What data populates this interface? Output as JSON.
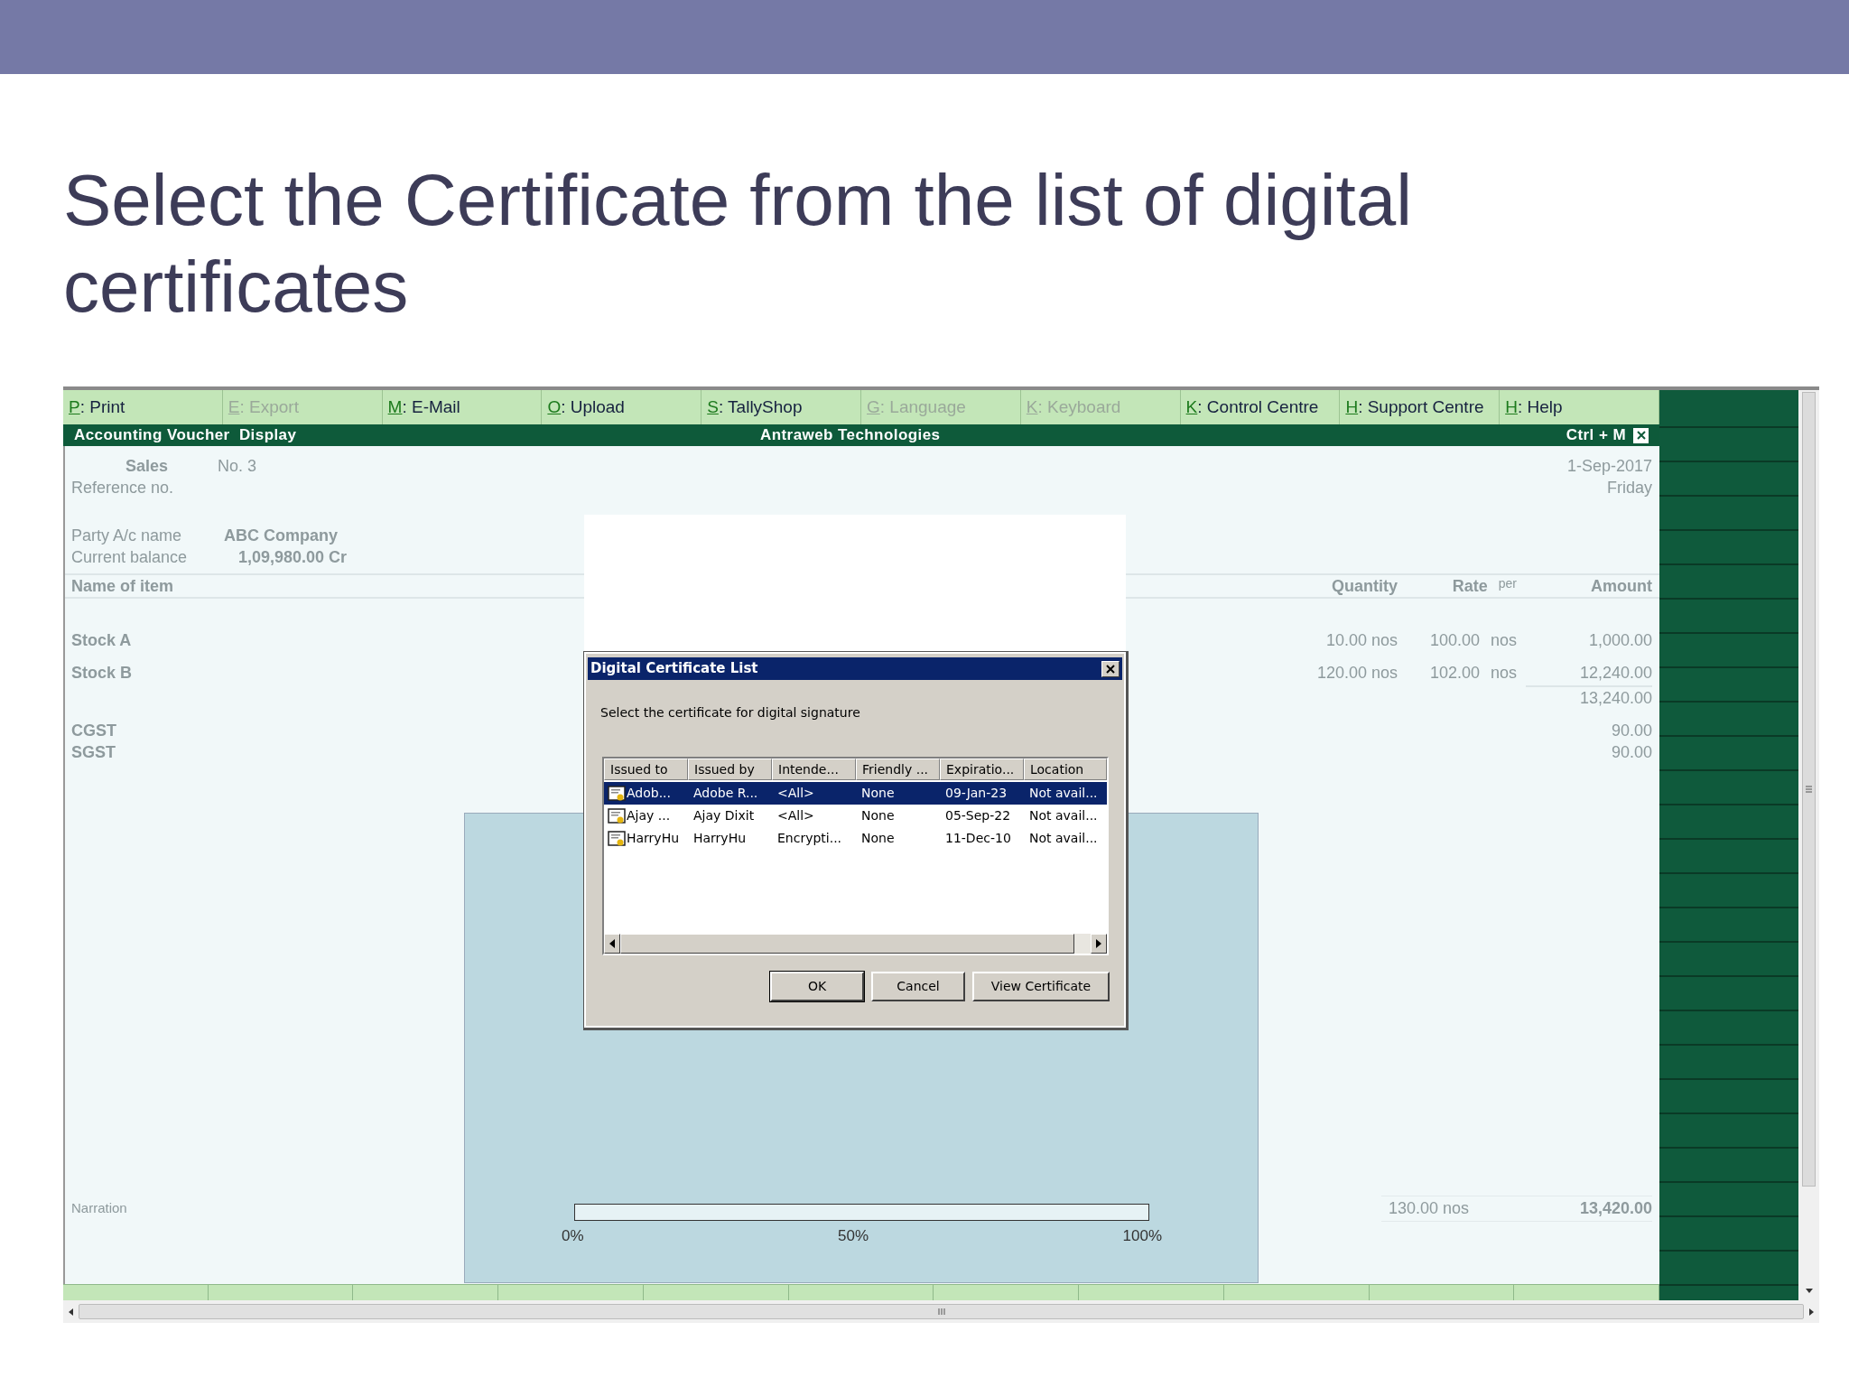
{
  "slide": {
    "title": "Select the Certificate from the list of digital certificates"
  },
  "menu": [
    {
      "key": "P",
      "label": ": Print",
      "disabled": false
    },
    {
      "key": "E",
      "label": ": Export",
      "disabled": true
    },
    {
      "key": "M",
      "label": ": E-Mail",
      "disabled": false
    },
    {
      "key": "O",
      "label": ": Upload",
      "disabled": false
    },
    {
      "key": "S",
      "label": ": TallyShop",
      "disabled": false
    },
    {
      "key": "G",
      "label": ": Language",
      "disabled": true
    },
    {
      "key": "K",
      "label": ": Keyboard",
      "disabled": true
    },
    {
      "key": "K",
      "label": ": Control Centre",
      "disabled": false
    },
    {
      "key": "H",
      "label": ": Support Centre",
      "disabled": false
    },
    {
      "key": "H",
      "label": ": Help",
      "disabled": false
    }
  ],
  "title_bar": {
    "screen": "Accounting Voucher  Display",
    "company": "Antraweb Technologies",
    "shortcut": "Ctrl + M"
  },
  "voucher": {
    "type": "Sales",
    "number": "No. 3",
    "date": "1-Sep-2017",
    "day": "Friday",
    "reference_label": "Reference no.",
    "party_label": "Party A/c name",
    "party": "ABC Company",
    "balance_label": "Current balance",
    "balance": "1,09,980.00 Cr",
    "columns": {
      "item": "Name of item",
      "quantity": "Quantity",
      "rate": "Rate",
      "per": "per",
      "amount": "Amount"
    },
    "items": [
      {
        "name": "Stock A",
        "quantity": "10.00 nos",
        "rate": "100.00",
        "unit": "nos",
        "amount": "1,000.00"
      },
      {
        "name": "Stock B",
        "quantity": "120.00 nos",
        "rate": "102.00",
        "unit": "nos",
        "amount": "12,240.00"
      }
    ],
    "subtotal": "13,240.00",
    "taxes": [
      {
        "name": "CGST",
        "amount": "90.00"
      },
      {
        "name": "SGST",
        "amount": "90.00"
      }
    ],
    "narration_label": "Narration",
    "total_quantity": "130.00 nos",
    "total_amount": "13,420.00"
  },
  "progress": {
    "level": 0,
    "ticks": [
      "0%",
      "50%",
      "100%"
    ]
  },
  "dialog": {
    "title": "Digital Certificate List",
    "instruction": "Select the certificate for digital signature",
    "columns": [
      "Issued to",
      "Issued by",
      "Intende...",
      "Friendly ...",
      "Expiratio...",
      "Location"
    ],
    "rows": [
      {
        "cells": [
          "Adob...",
          "Adobe R...",
          "<All>",
          "None",
          "09-Jan-23",
          "Not avail..."
        ],
        "selected": true
      },
      {
        "cells": [
          "Ajay ...",
          "Ajay Dixit",
          "<All>",
          "None",
          "05-Sep-22",
          "Not avail..."
        ],
        "selected": false
      },
      {
        "cells": [
          "HarryHu",
          "HarryHu",
          "Encrypti...",
          "None",
          "11-Dec-10",
          "Not avail..."
        ],
        "selected": false
      }
    ],
    "buttons": [
      {
        "label": "OK",
        "default": true
      },
      {
        "label": "Cancel",
        "default": false
      },
      {
        "label": "View Certificate",
        "default": false
      }
    ]
  }
}
